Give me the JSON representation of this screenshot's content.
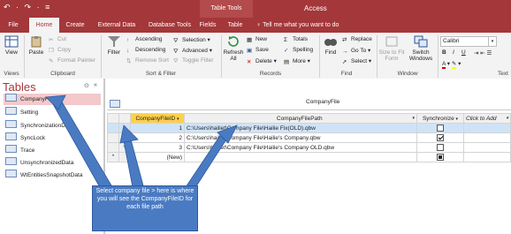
{
  "window": {
    "context_tab_group": "Table Tools",
    "app_title": "Access",
    "quick_access": "↶ · ↷ · ≡"
  },
  "tabs": [
    {
      "label": "File"
    },
    {
      "label": "Home"
    },
    {
      "label": "Create"
    },
    {
      "label": "External Data"
    },
    {
      "label": "Database Tools"
    },
    {
      "label": "Fields"
    },
    {
      "label": "Table"
    }
  ],
  "tell_me": "♀ Tell me what you want to do",
  "ribbon": {
    "views": {
      "view": "View",
      "group": "Views"
    },
    "clipboard": {
      "paste": "Paste",
      "cut": "Cut",
      "copy": "Copy",
      "format_painter": "Format Painter",
      "group": "Clipboard"
    },
    "sort_filter": {
      "filter": "Filter",
      "ascending": "Ascending",
      "descending": "Descending",
      "remove_sort": "Remove Sort",
      "selection": "Selection",
      "advanced": "Advanced",
      "toggle_filter": "Toggle Filter",
      "group": "Sort & Filter"
    },
    "records": {
      "refresh": "Refresh All",
      "new": "New",
      "save": "Save",
      "delete": "Delete",
      "totals": "Totals",
      "spelling": "Spelling",
      "more": "More",
      "group": "Records"
    },
    "find": {
      "find": "Find",
      "replace": "Replace",
      "goto": "Go To",
      "select": "Select",
      "group": "Find"
    },
    "window": {
      "size_to_fit": "Size to Fit Form",
      "switch": "Switch Windows",
      "group": "Window"
    },
    "text": {
      "font": "Calibri",
      "bold": "B",
      "italic": "I",
      "underline": "U",
      "group": "Text"
    }
  },
  "nav": {
    "title": "Tables",
    "items": [
      {
        "label": "CompanyFile"
      },
      {
        "label": "Setting"
      },
      {
        "label": "SynchronizationDa"
      },
      {
        "label": "SyncLock"
      },
      {
        "label": "Trace"
      },
      {
        "label": "UnsynchronizedData"
      },
      {
        "label": "WtEntitiesSnapshotData"
      }
    ]
  },
  "document": {
    "tab_label": "CompanyFile"
  },
  "grid": {
    "headers": {
      "id": "CompanyFileID",
      "path": "CompanyFilePath",
      "sync": "Synchronize",
      "add": "Click to Add"
    },
    "rows": [
      {
        "expand": "+",
        "id": "1",
        "path": "C:\\Users\\hailiet\\Company File\\Hailie Fix(OLD).qbw"
      },
      {
        "expand": "+",
        "id": "2",
        "path": "C:\\Users\\hailiet\\Company File\\Hailie's Company.qbw"
      },
      {
        "expand": "+",
        "id": "3",
        "path": "C:\\Users\\hailiet\\Company File\\Hailie's Company OLD.qbw"
      }
    ],
    "new_row": {
      "marker": "*",
      "id": "(New)"
    }
  },
  "callout": {
    "text": "Select company file > here is where you will see the CompanyFileID for each file path"
  },
  "colors": {
    "accent": "#a4373a",
    "callout": "#4a7bc2",
    "header_highlight": "#ffd04a"
  }
}
